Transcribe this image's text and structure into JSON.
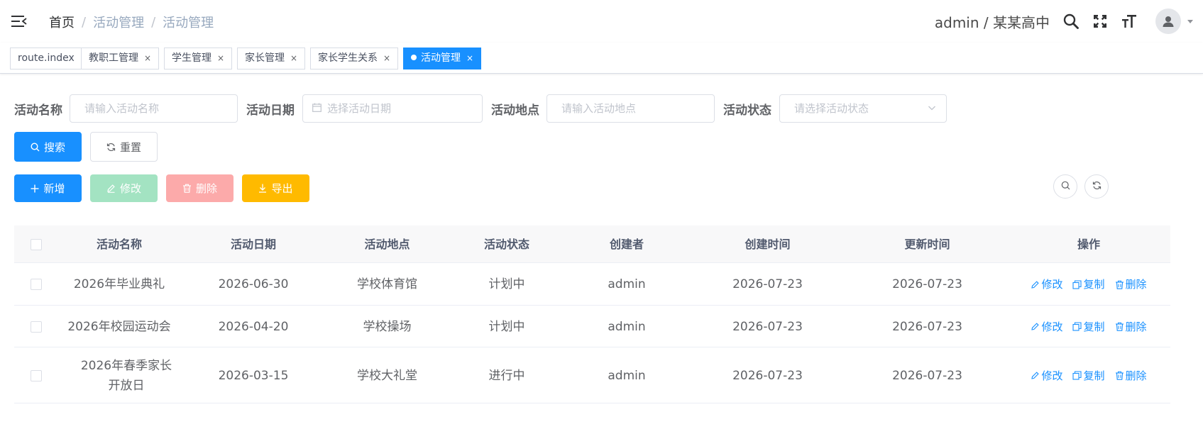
{
  "navbar": {
    "breadcrumb": [
      "首页",
      "活动管理",
      "活动管理"
    ],
    "user_text": "admin / 某某高中"
  },
  "tags": [
    {
      "label": "route.index",
      "closable": false,
      "active": false
    },
    {
      "label": "教职工管理",
      "closable": true,
      "active": false
    },
    {
      "label": "学生管理",
      "closable": true,
      "active": false
    },
    {
      "label": "家长管理",
      "closable": true,
      "active": false
    },
    {
      "label": "家长学生关系",
      "closable": true,
      "active": false
    },
    {
      "label": "活动管理",
      "closable": true,
      "active": true
    }
  ],
  "tag_close": "×",
  "search_form": {
    "name_label": "活动名称",
    "name_placeholder": "请输入活动名称",
    "date_label": "活动日期",
    "date_placeholder": "选择活动日期",
    "location_label": "活动地点",
    "location_placeholder": "请输入活动地点",
    "status_label": "活动状态",
    "status_placeholder": "请选择活动状态",
    "search_button": "搜索",
    "reset_button": "重置"
  },
  "toolbar": {
    "add": "新增",
    "edit": "修改",
    "delete": "删除",
    "export": "导出"
  },
  "table": {
    "columns": [
      "活动名称",
      "活动日期",
      "活动地点",
      "活动状态",
      "创建者",
      "创建时间",
      "更新时间",
      "操作"
    ],
    "rows": [
      {
        "name": "2026年毕业典礼",
        "date": "2026-06-30",
        "location": "学校体育馆",
        "status": "计划中",
        "creator": "admin",
        "created": "2026-07-23",
        "updated": "2026-07-23"
      },
      {
        "name": "2026年校园运动会",
        "date": "2026-04-20",
        "location": "学校操场",
        "status": "计划中",
        "creator": "admin",
        "created": "2026-07-23",
        "updated": "2026-07-23"
      },
      {
        "name": "2026年春季家长开放日",
        "date": "2026-03-15",
        "location": "学校大礼堂",
        "status": "进行中",
        "creator": "admin",
        "created": "2026-07-23",
        "updated": "2026-07-23"
      }
    ],
    "actions": {
      "edit": "修改",
      "copy": "复制",
      "delete": "删除"
    }
  },
  "colors": {
    "primary": "#1890ff",
    "success_disabled": "#a3e3c2",
    "danger_disabled": "#fcaaaa",
    "warning": "#ffba00"
  }
}
